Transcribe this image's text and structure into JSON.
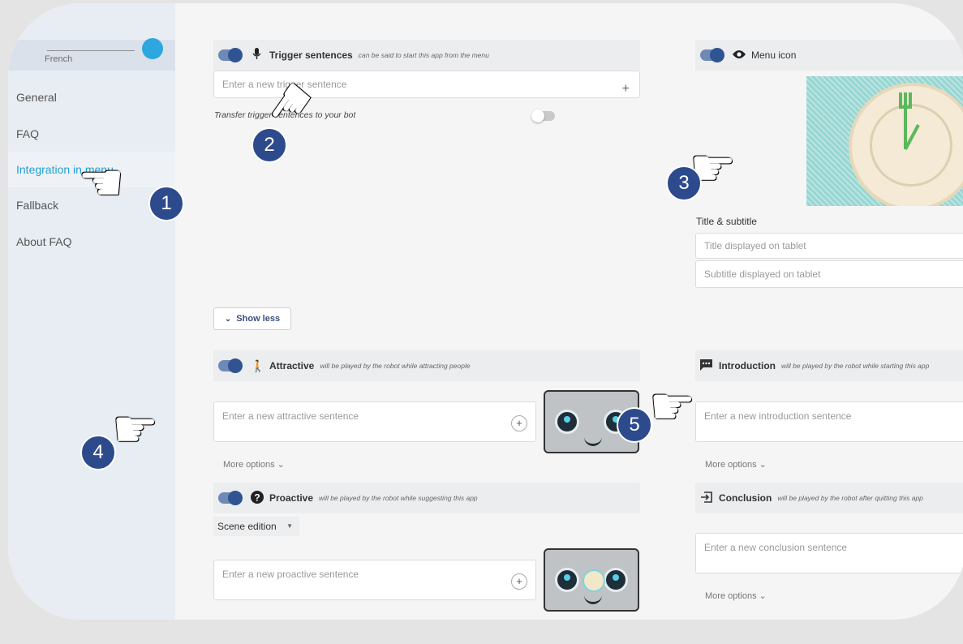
{
  "sidebar": {
    "language": "French",
    "items": [
      {
        "label": "General"
      },
      {
        "label": "FAQ"
      },
      {
        "label": "Integration in menu"
      },
      {
        "label": "Fallback"
      },
      {
        "label": "About FAQ"
      }
    ]
  },
  "trigger": {
    "title": "Trigger sentences",
    "subtitle": "can be said to start this app from the menu",
    "placeholder": "Enter a new trigger sentence",
    "transfer_label": "Transfer trigger sentences to your bot"
  },
  "menu_icon": {
    "title": "Menu icon",
    "title_subtitle_label": "Title & subtitle",
    "title_placeholder": "Title displayed on tablet",
    "subtitle_placeholder": "Subtitle displayed on tablet"
  },
  "show_less": "Show less",
  "attractive": {
    "title": "Attractive",
    "subtitle": "will be played by the robot while attracting people",
    "placeholder": "Enter a new attractive sentence",
    "more": "More options"
  },
  "introduction": {
    "title": "Introduction",
    "subtitle": "will be played by the robot while starting this app",
    "placeholder": "Enter a new introduction sentence",
    "more": "More options"
  },
  "proactive": {
    "title": "Proactive",
    "subtitle": "will be played by the robot while suggesting this app",
    "scene_edition": "Scene edition",
    "placeholder": "Enter a new proactive sentence"
  },
  "conclusion": {
    "title": "Conclusion",
    "subtitle": "will be played by the robot after quitting this app",
    "placeholder": "Enter a new conclusion sentence",
    "more": "More options"
  },
  "steps": [
    "1",
    "2",
    "3",
    "4",
    "5"
  ],
  "colors": {
    "accent": "#23a0d6",
    "toggle": "#2f5491",
    "badge": "#2d4a8c"
  }
}
